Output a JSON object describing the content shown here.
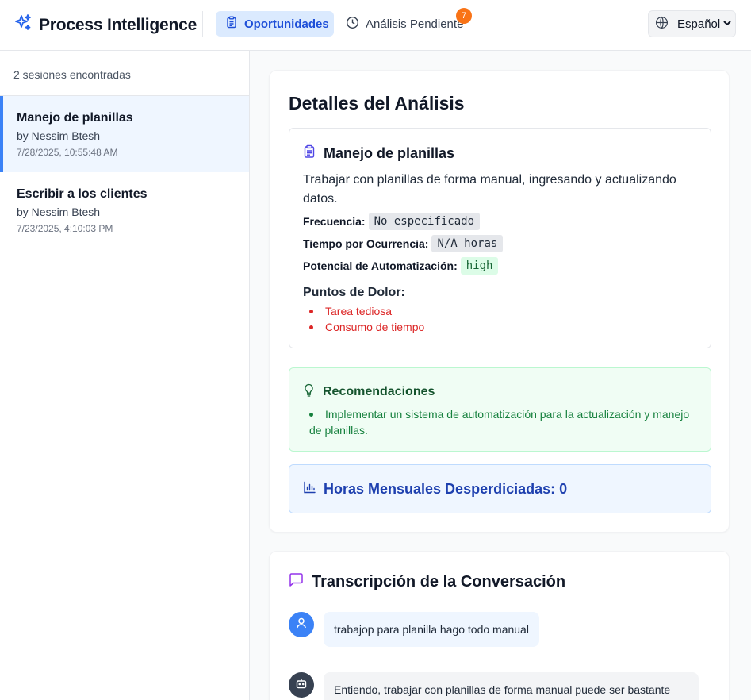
{
  "header": {
    "brand": "Process Intelligence",
    "nav_opportunities": "Oportunidades",
    "nav_pending": "Análisis Pendiente",
    "pending_badge": "7",
    "language": "Español"
  },
  "sidebar": {
    "count_text": "2 sesiones encontradas",
    "sessions": [
      {
        "title": "Manejo de planillas",
        "by": "by Nessim Btesh",
        "date": "7/28/2025, 10:55:48 AM",
        "active": true
      },
      {
        "title": "Escribir a los clientes",
        "by": "by Nessim Btesh",
        "date": "7/23/2025, 4:10:03 PM",
        "active": false
      }
    ]
  },
  "details": {
    "title": "Detalles del Análisis",
    "opportunity": {
      "title": "Manejo de planillas",
      "description": "Trabajar con planillas de forma manual, ingresando y actualizando datos.",
      "frequency_label": "Frecuencia:",
      "frequency_value": "No especificado",
      "time_label": "Tiempo por Ocurrencia:",
      "time_value": "N/A horas",
      "automation_label": "Potencial de Automatización:",
      "automation_value": "high",
      "pain_points_title": "Puntos de Dolor:",
      "pain_points": [
        "Tarea tediosa",
        "Consumo de tiempo"
      ]
    },
    "recommendations": {
      "title": "Recomendaciones",
      "items": [
        "Implementar un sistema de automatización para la actualización y manejo de planillas."
      ]
    },
    "hours_text": "Horas Mensuales Desperdiciadas: 0"
  },
  "transcript": {
    "title": "Transcripción de la Conversación",
    "messages": [
      {
        "role": "user",
        "text": "trabajop para planilla hago todo manual"
      },
      {
        "role": "assistant",
        "text": "Entiendo, trabajar con planillas de forma manual puede ser bastante"
      }
    ]
  },
  "colors": {
    "accent": "#3b82f6",
    "nav_active_bg": "#dbeafe",
    "badge": "#f97316",
    "pain_red": "#dc2626",
    "rec_green": "#15803d",
    "hours_blue": "#1e40af",
    "transcript_icon": "#9333ea"
  },
  "icons": {
    "brand": "sparkles-icon",
    "nav_opportunities": "clipboard-icon",
    "nav_pending": "clock-icon",
    "language": "globe-icon",
    "opportunity": "clipboard-icon",
    "recommendations": "lightbulb-icon",
    "hours": "bar-chart-icon",
    "transcript": "message-square-icon",
    "user": "user-icon",
    "assistant": "bot-icon"
  }
}
